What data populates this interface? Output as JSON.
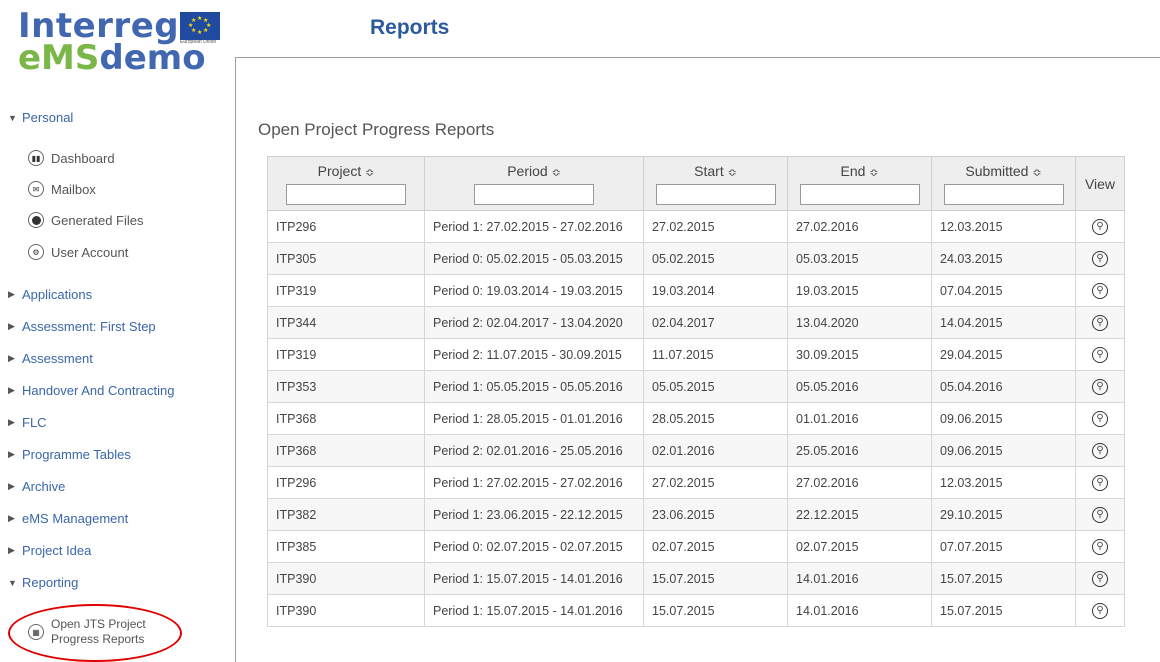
{
  "logo": {
    "line1": "Interreg",
    "line2_ems": "eMS",
    "line2_demo": "demo",
    "eu_caption": "European Union"
  },
  "page_title": "Reports",
  "sidebar": {
    "personal": {
      "label": "Personal",
      "items": [
        {
          "label": "Dashboard",
          "icon": "dashboard-icon"
        },
        {
          "label": "Mailbox",
          "icon": "mail-icon"
        },
        {
          "label": "Generated Files",
          "icon": "files-icon"
        },
        {
          "label": "User Account",
          "icon": "gear-icon"
        }
      ]
    },
    "sections": [
      {
        "label": "Applications"
      },
      {
        "label": "Assessment: First Step"
      },
      {
        "label": "Assessment"
      },
      {
        "label": "Handover And Contracting"
      },
      {
        "label": "FLC"
      },
      {
        "label": "Programme Tables"
      },
      {
        "label": "Archive"
      },
      {
        "label": "eMS Management"
      },
      {
        "label": "Project Idea"
      }
    ],
    "reporting": {
      "label": "Reporting",
      "item_line1": "Open JTS Project",
      "item_line2": "Progress Reports"
    }
  },
  "main": {
    "title": "Open Project Progress Reports",
    "columns": [
      "Project",
      "Period",
      "Start",
      "End",
      "Submitted",
      "View"
    ],
    "rows": [
      [
        "ITP296",
        "Period 1: 27.02.2015 - 27.02.2016",
        "27.02.2015",
        "27.02.2016",
        "12.03.2015"
      ],
      [
        "ITP305",
        "Period 0: 05.02.2015 - 05.03.2015",
        "05.02.2015",
        "05.03.2015",
        "24.03.2015"
      ],
      [
        "ITP319",
        "Period 0: 19.03.2014 - 19.03.2015",
        "19.03.2014",
        "19.03.2015",
        "07.04.2015"
      ],
      [
        "ITP344",
        "Period 2: 02.04.2017 - 13.04.2020",
        "02.04.2017",
        "13.04.2020",
        "14.04.2015"
      ],
      [
        "ITP319",
        "Period 2: 11.07.2015 - 30.09.2015",
        "11.07.2015",
        "30.09.2015",
        "29.04.2015"
      ],
      [
        "ITP353",
        "Period 1: 05.05.2015 - 05.05.2016",
        "05.05.2015",
        "05.05.2016",
        "05.04.2016"
      ],
      [
        "ITP368",
        "Period 1: 28.05.2015 - 01.01.2016",
        "28.05.2015",
        "01.01.2016",
        "09.06.2015"
      ],
      [
        "ITP368",
        "Period 2: 02.01.2016 - 25.05.2016",
        "02.01.2016",
        "25.05.2016",
        "09.06.2015"
      ],
      [
        "ITP296",
        "Period 1: 27.02.2015 - 27.02.2016",
        "27.02.2015",
        "27.02.2016",
        "12.03.2015"
      ],
      [
        "ITP382",
        "Period 1: 23.06.2015 - 22.12.2015",
        "23.06.2015",
        "22.12.2015",
        "29.10.2015"
      ],
      [
        "ITP385",
        "Period 0: 02.07.2015 - 02.07.2015",
        "02.07.2015",
        "02.07.2015",
        "07.07.2015"
      ],
      [
        "ITP390",
        "Period 1: 15.07.2015 - 14.01.2016",
        "15.07.2015",
        "14.01.2016",
        "15.07.2015"
      ],
      [
        "ITP390",
        "Period 1: 15.07.2015 - 14.01.2016",
        "15.07.2015",
        "14.01.2016",
        "15.07.2015"
      ]
    ]
  },
  "colors": {
    "accent": "#2c5a9e",
    "link": "#3a66a8",
    "highlight": "#e00000"
  }
}
